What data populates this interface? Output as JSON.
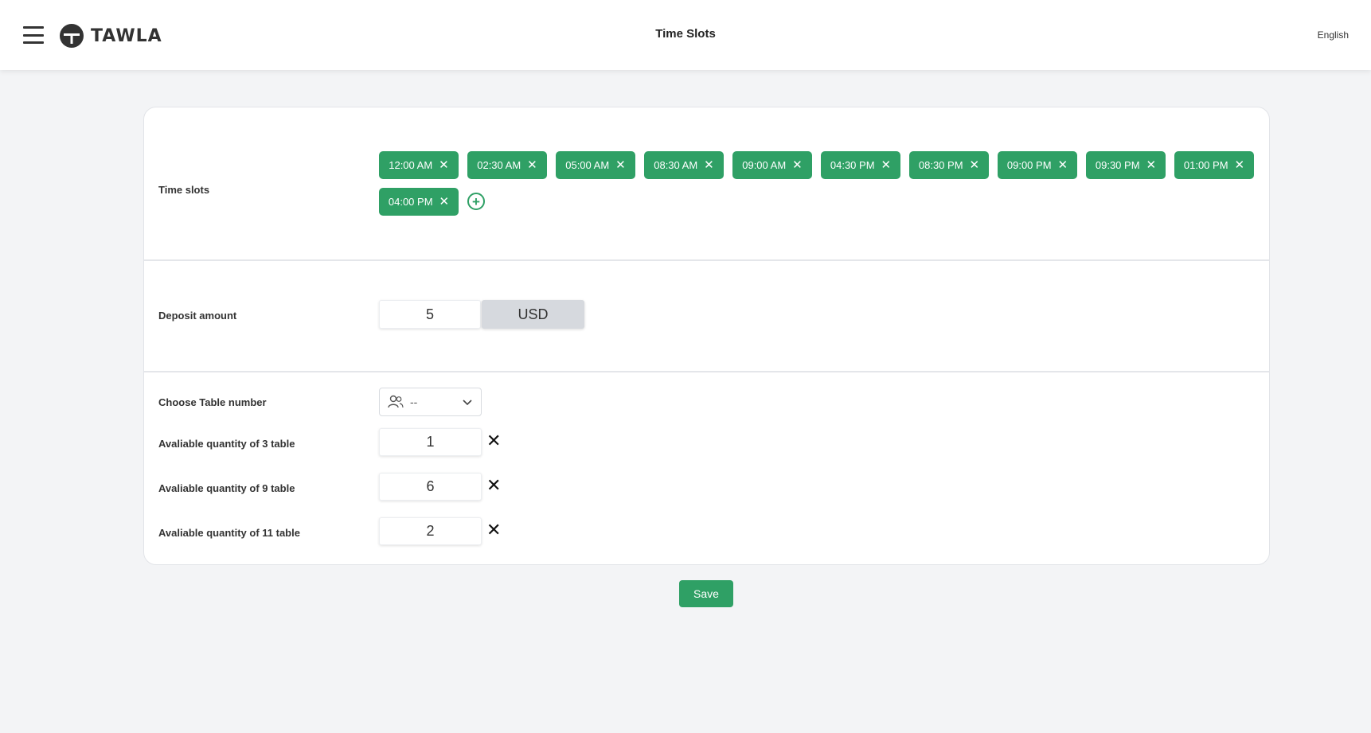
{
  "header": {
    "app_name": "TAWLA",
    "page_title": "Time Slots",
    "language": "English"
  },
  "time_slots": {
    "label": "Time slots",
    "slots": [
      "12:00 AM",
      "02:30 AM",
      "05:00 AM",
      "08:30 AM",
      "09:00 AM",
      "04:30 PM",
      "08:30 PM",
      "09:00 PM",
      "09:30 PM",
      "01:00 PM",
      "04:00 PM"
    ],
    "remove_glyph": "✕",
    "add_glyph": "+"
  },
  "deposit": {
    "label": "Deposit amount",
    "amount": "5",
    "currency": "USD"
  },
  "tables": {
    "choose_label": "Choose Table number",
    "select_value": "--",
    "quantities": [
      {
        "label": "Avaliable quantity of 3 table",
        "value": "1"
      },
      {
        "label": "Avaliable quantity of 9 table",
        "value": "6"
      },
      {
        "label": "Avaliable quantity of 11 table",
        "value": "2"
      }
    ],
    "remove_glyph": "✕"
  },
  "actions": {
    "save_label": "Save"
  },
  "colors": {
    "accent": "#2fa065",
    "background": "#f3f4f6"
  }
}
